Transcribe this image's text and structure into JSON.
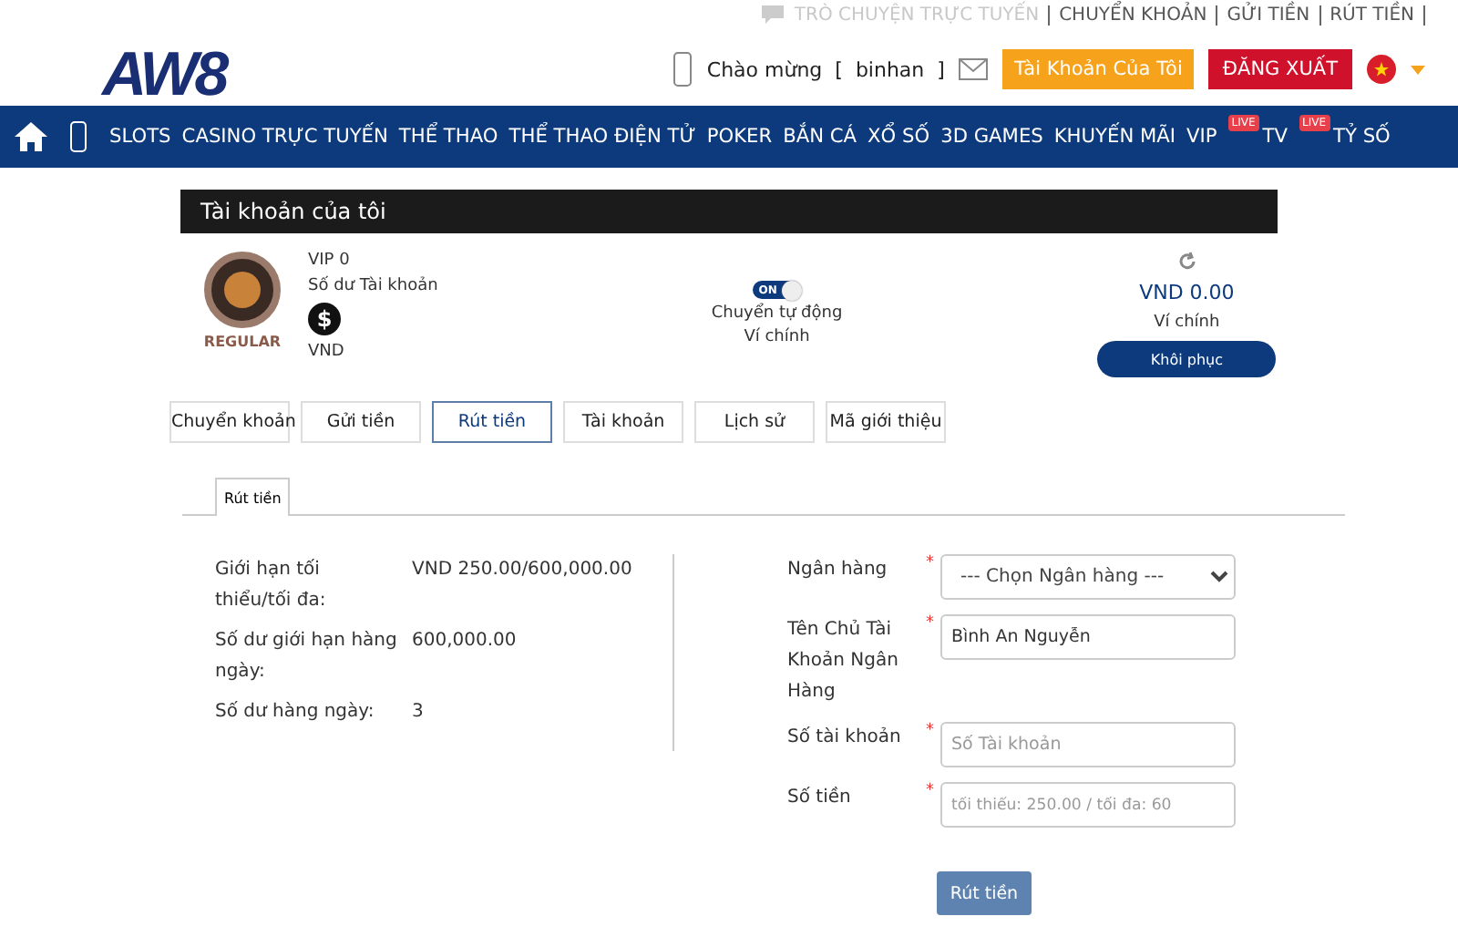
{
  "logo": {
    "text": "AW8"
  },
  "top_links": [
    {
      "label": "TRÒ CHUYỆN TRỰC TUYẾN",
      "disabled": true
    },
    {
      "label": "CHUYỂN KHOẢN",
      "disabled": false
    },
    {
      "label": "GỬI TIỀN",
      "disabled": false
    },
    {
      "label": "RÚT TIỀN",
      "disabled": false
    }
  ],
  "greeting": {
    "label": "Chào mừng",
    "open": "[",
    "username": "binhan",
    "close": "]"
  },
  "account_button": "Tài Khoản Của Tôi",
  "logout_button": "ĐĂNG XUẤT",
  "nav": [
    {
      "label": "SLOTS"
    },
    {
      "label": "CASINO TRỰC TUYẾN"
    },
    {
      "label": "THỂ THAO"
    },
    {
      "label": "THỂ THAO ĐIỆN TỬ"
    },
    {
      "label": "POKER"
    },
    {
      "label": "BẮN CÁ"
    },
    {
      "label": "XỔ SỐ"
    },
    {
      "label": "3D GAMES"
    },
    {
      "label": "KHUYẾN MÃI"
    },
    {
      "label": "VIP"
    },
    {
      "label": "TV",
      "badge": "LIVE"
    },
    {
      "label": "TỶ SỐ",
      "badge": "LIVE"
    }
  ],
  "page_title": "Tài khoản của tôi",
  "profile": {
    "tier": "REGULAR",
    "vip": "VIP 0",
    "balance_label": "Số dư Tài khoản",
    "currency_symbol": "$",
    "currency": "VND",
    "auto_transfer": {
      "on": true,
      "state_label": "ON",
      "label": "Chuyển tự động",
      "sublabel": "Ví chính"
    },
    "wallet": {
      "amount": "VND 0.00",
      "label": "Ví chính",
      "button": "Khôi phục"
    }
  },
  "tabs": [
    {
      "label": "Chuyển khoản",
      "selected": false
    },
    {
      "label": "Gửi tiền",
      "selected": false
    },
    {
      "label": "Rút tiền",
      "selected": true
    },
    {
      "label": "Tài khoản",
      "selected": false
    },
    {
      "label": "Lịch sử",
      "selected": false
    },
    {
      "label": "Mã giới thiệu",
      "selected": false
    }
  ],
  "subtab": {
    "label": "Rút tiền"
  },
  "limits": [
    {
      "label": "Giới hạn tối thiểu/tối đa:",
      "value": "VND 250.00/600,000.00"
    },
    {
      "label": "Số dư giới hạn hàng ngày:",
      "value": "600,000.00"
    },
    {
      "label": "Số dư hàng ngày:",
      "value": "3"
    }
  ],
  "form": [
    {
      "kind": "select",
      "label": "Ngân hàng",
      "required": true,
      "value": "--- Chọn Ngân hàng ---"
    },
    {
      "kind": "text",
      "label": "Tên Chủ Tài Khoản Ngân Hàng",
      "required": true,
      "value": "Bình An Nguyễn"
    },
    {
      "kind": "text",
      "label": "Số tài khoản",
      "required": true,
      "placeholder": "Số Tài khoản"
    },
    {
      "kind": "text",
      "label": "Số tiền",
      "required": true,
      "placeholder": "tối thiểu: 250.00 / tối đa: 60"
    }
  ],
  "required_mark": "*",
  "submit_button": "Rút tiền"
}
